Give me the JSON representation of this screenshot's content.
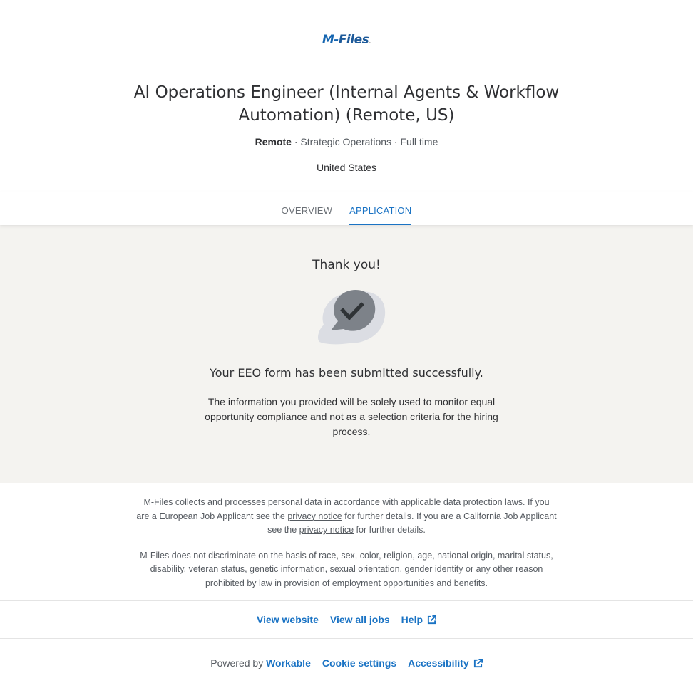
{
  "brand": {
    "logo_m": "M-",
    "logo_rest": "Files",
    "logo_dot": "."
  },
  "job": {
    "title": "AI Operations Engineer (Internal Agents & Workflow Automation) (Remote, US)",
    "workplace": "Remote",
    "separator": " · ",
    "department": "Strategic Operations",
    "type": "Full time",
    "location": "United States"
  },
  "tabs": [
    {
      "label": "OVERVIEW",
      "active": false
    },
    {
      "label": "APPLICATION",
      "active": true
    }
  ],
  "confirmation": {
    "title": "Thank you!",
    "icon": "check-bubble-icon",
    "message": "Your EEO form has been submitted successfully.",
    "details": "The information you provided will be solely used to monitor equal opportunity compliance and not as a selection criteria for the hiring process."
  },
  "legal": {
    "p1_a": "M-Files collects and processes personal data in accordance with applicable data protection laws. If you are a European Job Applicant see the ",
    "p1_link1": "privacy notice",
    "p1_b": " for further details. If you are a California Job Applicant see the ",
    "p1_link2": "privacy notice",
    "p1_c": " for further details.",
    "p2": "M-Files does not discriminate on the basis of race, sex, color, religion, age, national origin, marital status, disability, veteran status, genetic information, sexual orientation, gender identity or any other reason prohibited by law in provision of employment opportunities and benefits."
  },
  "footer_links": {
    "view_website": "View website",
    "view_all_jobs": "View all jobs",
    "help": "Help"
  },
  "powered": {
    "prefix": "Powered by",
    "workable": "Workable",
    "cookie_settings": "Cookie settings",
    "accessibility": "Accessibility"
  },
  "colors": {
    "accent": "#1a73c4",
    "panel_bg": "#f4f3f0",
    "icon_dark": "#7d8289",
    "icon_light": "#dbdde3"
  }
}
